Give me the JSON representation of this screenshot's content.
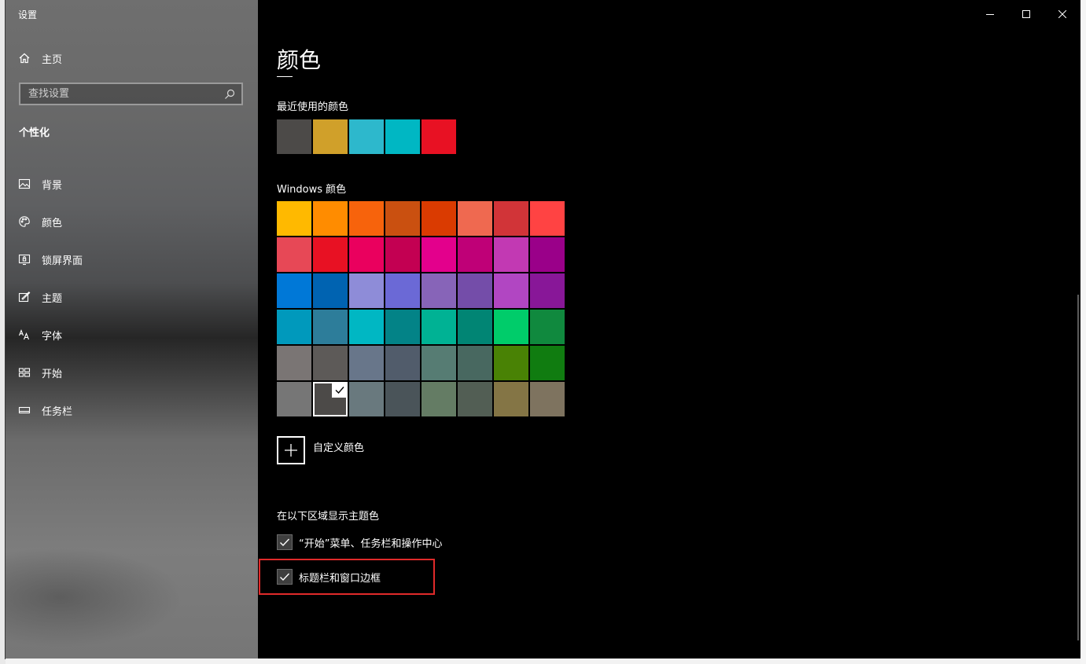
{
  "window": {
    "title": "设置",
    "caption": {
      "minimize": "minimize-icon",
      "maximize": "maximize-icon",
      "close": "close-icon"
    }
  },
  "sidebar": {
    "home": {
      "label": "主页",
      "icon": "home-icon"
    },
    "search": {
      "placeholder": "查找设置",
      "icon": "search-icon"
    },
    "section_title": "个性化",
    "items": [
      {
        "label": "背景",
        "icon": "picture-icon"
      },
      {
        "label": "颜色",
        "icon": "palette-icon"
      },
      {
        "label": "锁屏界面",
        "icon": "lock-screen-icon"
      },
      {
        "label": "主题",
        "icon": "theme-icon"
      },
      {
        "label": "字体",
        "icon": "font-icon"
      },
      {
        "label": "开始",
        "icon": "start-icon"
      },
      {
        "label": "任务栏",
        "icon": "taskbar-icon"
      }
    ]
  },
  "main": {
    "title": "颜色",
    "recent_label": "最近使用的颜色",
    "recent_colors": [
      "#4c4a48",
      "#d0a02a",
      "#2db8cc",
      "#00b7c3",
      "#e81123"
    ],
    "windows_label": "Windows 颜色",
    "windows_colors": [
      [
        "#ffb900",
        "#ff8c00",
        "#f7630c",
        "#ca5010",
        "#da3b01",
        "#ef6950",
        "#d13438",
        "#ff4343"
      ],
      [
        "#e74856",
        "#e81123",
        "#ea005e",
        "#c30052",
        "#e3008c",
        "#bf0077",
        "#c239b3",
        "#9a0089"
      ],
      [
        "#0078d7",
        "#0063b1",
        "#8e8cd8",
        "#6b69d6",
        "#8764b8",
        "#744da9",
        "#b146c2",
        "#881798"
      ],
      [
        "#0099bc",
        "#2d7d9a",
        "#00b7c3",
        "#038387",
        "#00b294",
        "#018574",
        "#00cc6a",
        "#10893e"
      ],
      [
        "#7a7574",
        "#5d5a58",
        "#68768a",
        "#515c6b",
        "#567c73",
        "#486860",
        "#498205",
        "#107c10"
      ],
      [
        "#767676",
        "#4c4a48",
        "#69797e",
        "#4a5459",
        "#647c64",
        "#525e54",
        "#847545",
        "#7e735f"
      ]
    ],
    "selected_color": "#4c4a48",
    "custom_color_label": "自定义颜色",
    "show_accent_label": "在以下区域显示主题色",
    "checkboxes": [
      {
        "label": "“开始”菜单、任务栏和操作中心",
        "checked": true
      },
      {
        "label": "标题栏和窗口边框",
        "checked": true
      }
    ]
  }
}
